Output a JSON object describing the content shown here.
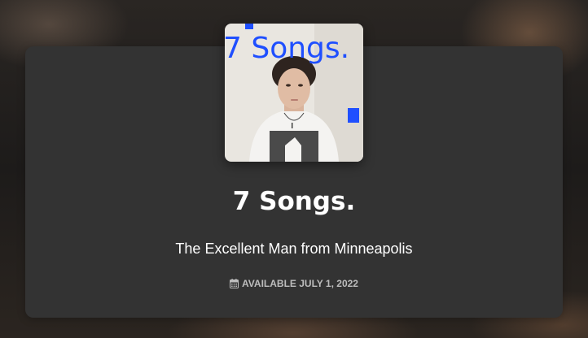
{
  "release": {
    "title": "7 Songs.",
    "subtitle": "The Excellent Man from Minneapolis",
    "availability": "AVAILABLE JULY 1, 2022"
  },
  "cover_art": {
    "text": "7 Songs.",
    "text_color": "#1f4fff"
  },
  "icons": {
    "availability_icon": "calendar-icon"
  },
  "colors": {
    "card_background": "#333333",
    "title_color": "#ffffff",
    "availability_color": "#bdbdbd"
  }
}
